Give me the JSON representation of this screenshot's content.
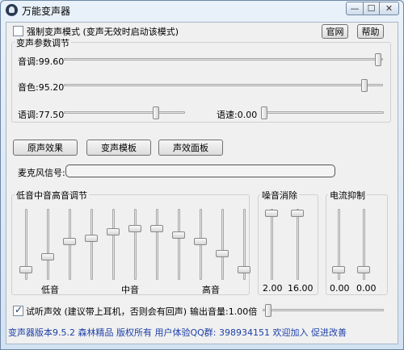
{
  "window": {
    "title": "万能变声器",
    "min_glyph": "—",
    "max_glyph": "☐",
    "close_glyph": "✕"
  },
  "top": {
    "force_mode_label": "强制变声模式 (变声无效时启动该模式)",
    "force_mode_checked": false,
    "website_button": "官网",
    "help_button": "帮助"
  },
  "params": {
    "title": "变声参数调节",
    "pitch": {
      "label": "音调:",
      "value": "99.60",
      "level": 0.996
    },
    "timbre": {
      "label": "音色:",
      "value": "95.20",
      "level": 0.952
    },
    "tone": {
      "label": "语调:",
      "value": "77.50",
      "level": 0.775
    },
    "speed": {
      "label": "语速:",
      "value": "0.00",
      "level": 0.0
    }
  },
  "buttons": {
    "original": "原声效果",
    "template": "变声模板",
    "effects": "声效面板"
  },
  "mic": {
    "label": "麦克风信号:",
    "level": 0
  },
  "eq": {
    "title": "低音中音高音调节",
    "low_label": "低音",
    "mid_label": "中音",
    "high_label": "高音",
    "bands": [
      0.1,
      0.3,
      0.55,
      0.6,
      0.7,
      0.75,
      0.75,
      0.65,
      0.55,
      0.35,
      0.1
    ]
  },
  "noise": {
    "title": "噪音消除",
    "values": [
      "2.00",
      "16.00"
    ],
    "levels": [
      0.99,
      0.99
    ]
  },
  "current": {
    "title": "电流抑制",
    "values": [
      "0.00",
      "0.00"
    ],
    "levels": [
      0.1,
      0.1
    ]
  },
  "monitor": {
    "label": "试听声效 (建议带上耳机，否则会有回声)",
    "checked": true,
    "volume_label": "输出音量:",
    "volume_value": "1.00倍",
    "volume_level": 0.02
  },
  "status": {
    "text": "变声器版本9.5.2  森林精品  版权所有  用户体验QQ群: 398934151  欢迎加入  促进改善"
  },
  "colors": {
    "status_text": "#1c3fa8",
    "client_bg": "#f0f0f0"
  }
}
